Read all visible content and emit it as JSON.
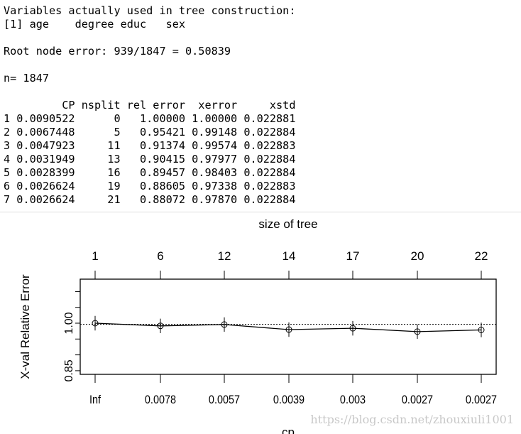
{
  "console": {
    "lines": [
      "Variables actually used in tree construction:",
      "[1] age    degree educ   sex",
      "",
      "Root node error: 939/1847 = 0.50839",
      "",
      "n= 1847",
      ""
    ],
    "table": {
      "header": "         CP nsplit rel error  xerror     xstd",
      "rows": [
        "1 0.0090522      0   1.00000 1.00000 0.022881",
        "2 0.0067448      5   0.95421 0.99148 0.022884",
        "3 0.0047923     11   0.91374 0.99574 0.022883",
        "4 0.0031949     13   0.90415 0.97977 0.022884",
        "5 0.0028399     16   0.89457 0.98403 0.022884",
        "6 0.0026624     19   0.88605 0.97338 0.022883",
        "7 0.0026624     21   0.88072 0.97870 0.022884"
      ]
    }
  },
  "chart_data": {
    "type": "line",
    "title": "",
    "top_axis_label": "size of tree",
    "top_tick_labels": [
      "1",
      "6",
      "12",
      "14",
      "17",
      "20",
      "22"
    ],
    "xlabel": "cp",
    "ylabel": "X-val Relative Error",
    "x_tick_labels": [
      "Inf",
      "0.0078",
      "0.0057",
      "0.0039",
      "0.003",
      "0.0027",
      "0.0027"
    ],
    "y_ticks": [
      0.85,
      0.9,
      0.95,
      1.0,
      1.05,
      1.1
    ],
    "y_tick_labels": [
      "0.85",
      "",
      "",
      "1.00",
      "",
      ""
    ],
    "ylim": [
      0.835,
      1.14
    ],
    "values": [
      1.0,
      0.99148,
      0.99574,
      0.97977,
      0.98403,
      0.97338,
      0.9787
    ],
    "error": [
      0.022881,
      0.022884,
      0.022883,
      0.022884,
      0.022884,
      0.022883,
      0.022884
    ],
    "reference_line": 0.99626,
    "reference_style": "dotted",
    "marker": "open-circle",
    "grid": false
  },
  "watermark": "https://blog.csdn.net/zhouxiuli1001"
}
